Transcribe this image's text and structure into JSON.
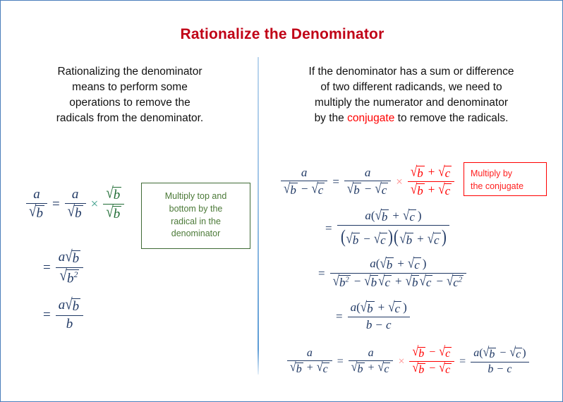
{
  "page": {
    "title": "Rationalize the Denominator",
    "title_color": "#c00016",
    "border_color": "#4a7ebb",
    "divider_color": "#5b9bd5",
    "background": "#ffffff"
  },
  "left_panel": {
    "description_lines": [
      "Rationalizing the denominator",
      "means to perform some",
      "operations to remove the",
      "radicals from the denominator."
    ],
    "callout": {
      "color": "#4c7a38",
      "border_color": "#3f6b35",
      "lines": [
        "Multiply top and",
        "bottom by the",
        "radical in the",
        "denominator"
      ]
    },
    "equation": {
      "step1_lhs_num": "a",
      "step1_lhs_den_radicand": "b",
      "equals": "=",
      "step1_rhs_num": "a",
      "step1_rhs_den_radicand": "b",
      "times": "×",
      "multiplier_num_radicand": "b",
      "multiplier_den_radicand": "b",
      "multiplier_color": "#1e6b33",
      "step2_num_coef": "a",
      "step2_num_radicand": "b",
      "step2_den_radicand": "b",
      "step2_den_exponent": "2",
      "step3_num_coef": "a",
      "step3_num_radicand": "b",
      "step3_den": "b"
    }
  },
  "right_panel": {
    "description": {
      "line1": "If the denominator has a sum or difference",
      "line2": "of two different radicands, we need to",
      "line3": "multiply the numerator and denominator",
      "line4_before": "by the ",
      "line4_highlight": "conjugate",
      "line4_after": " to remove the radicals.",
      "highlight_color": "#ff0000"
    },
    "callout": {
      "color": "#ff2020",
      "border_color": "#ff0000",
      "lines": [
        "Multiply by",
        "the conjugate"
      ]
    },
    "equation": {
      "numerator": "a",
      "radicand_b": "b",
      "radicand_c": "c",
      "minus": "−",
      "plus": "+",
      "equals": "=",
      "times": "×",
      "exponent": "2",
      "final_den_b": "b",
      "final_den_c": "c",
      "conjugate_color": "#ff0000",
      "step1_label": "a/(√b − √c) = a/(√b − √c) × (√b + √c)/(√b + √c)",
      "step2_label": "= a(√b + √c) / ((√b − √c)(√b + √c))",
      "step3_label": "= a(√b + √c) / (√b² − √b√c + √b√c − √c²)",
      "step4_label": "= a(√b + √c) / (b − c)"
    },
    "bottom_equation": {
      "label": "a/(√b + √c) = a/(√b + √c) × (√b − √c)/(√b − √c) = a(√b − √c)/(b − c)",
      "numerator": "a",
      "radicand_b": "b",
      "radicand_c": "c",
      "plus": "+",
      "minus": "−",
      "equals": "=",
      "times": "×",
      "final_den_b": "b",
      "final_den_c": "c"
    }
  },
  "glyphs": {
    "radical": "√",
    "paren_open": "(",
    "paren_close": ")"
  }
}
